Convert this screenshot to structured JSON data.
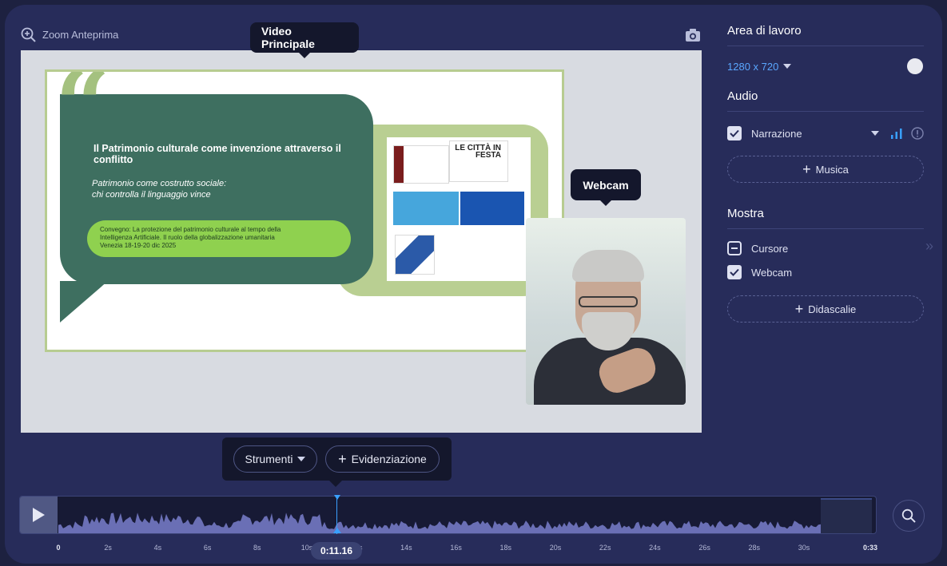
{
  "preview": {
    "zoom_label": "Zoom Anteprima",
    "main_tooltip": "Video Principale",
    "webcam_tooltip": "Webcam"
  },
  "slide": {
    "title": "Il Patrimonio culturale come invenzione attraverso il conflitto",
    "subtitle_line1": "Patrimonio come costrutto sociale:",
    "subtitle_line2": "chi controlla il linguaggio vince",
    "pill_line1": "Convegno: La protezione del patrimonio culturale al tempo della",
    "pill_line2": "Intelligenza Artificiale.  Il ruolo della globalizzazione umanitaria",
    "pill_line3": "Venezia 18-19-20 dic 2025",
    "logo_text": "LE CITTÀ IN FESTA"
  },
  "panel": {
    "workspace_title": "Area di lavoro",
    "resolution": "1280 x 720",
    "audio_title": "Audio",
    "narration_label": "Narrazione",
    "music_label": "Musica",
    "show_title": "Mostra",
    "cursor_label": "Cursore",
    "webcam_label": "Webcam",
    "captions_label": "Didascalie"
  },
  "toolbar": {
    "tools_label": "Strumenti",
    "highlight_label": "Evidenziazione"
  },
  "timeline": {
    "current_time": "0:11.16",
    "duration": "0:33",
    "ticks": [
      "0",
      "2s",
      "4s",
      "6s",
      "8s",
      "10s",
      "12s",
      "14s",
      "16s",
      "18s",
      "20s",
      "22s",
      "24s",
      "26s",
      "28s",
      "30s"
    ]
  },
  "colors": {
    "accent": "#39a0ff",
    "background": "#272c5a",
    "waveform": "#6a6fb5"
  }
}
